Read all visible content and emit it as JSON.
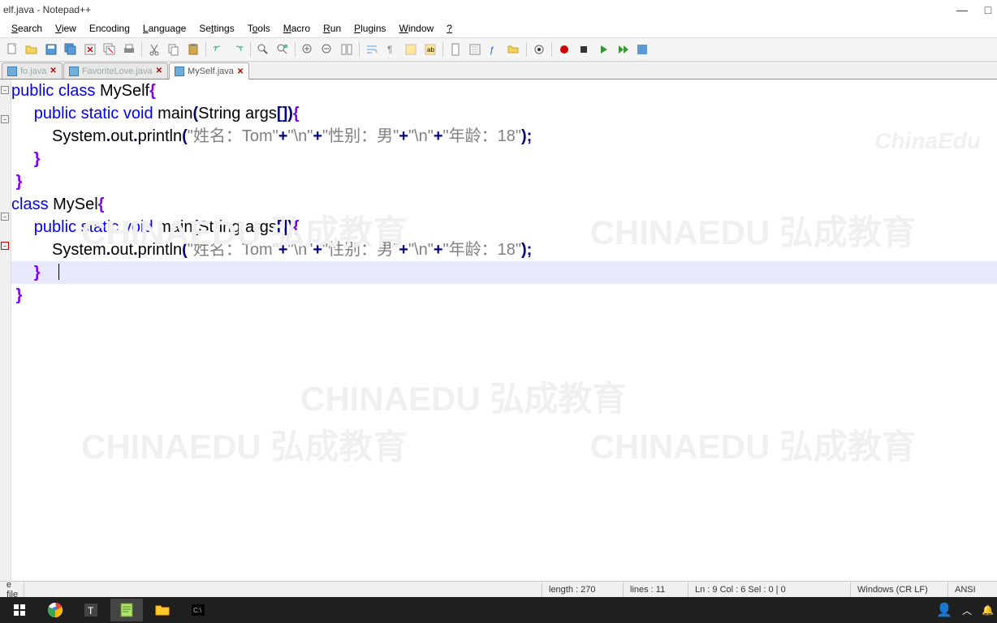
{
  "title": "elf.java - Notepad++",
  "menu": [
    "Search",
    "View",
    "Encoding",
    "Language",
    "Settings",
    "Tools",
    "Macro",
    "Run",
    "Plugins",
    "Window",
    "?"
  ],
  "tabs": [
    {
      "name": "fo.java",
      "active": false
    },
    {
      "name": "FavoriteLove.java",
      "active": false
    },
    {
      "name": "MySelf.java",
      "active": true
    }
  ],
  "code": {
    "line1_kw1": "public",
    "line1_kw2": "class",
    "line1_cls": "MySelf",
    "line2_kw1": "public",
    "line2_kw2": "static",
    "line2_kw3": "void",
    "line2_fn": "main",
    "line2_param": "String args",
    "line3_obj": "System",
    "line3_m1": "out",
    "line3_m2": "println",
    "line3_s1": "\"姓名：Tom\"",
    "line3_s2": "\"\\n\"",
    "line3_s3": "\"性别：男\"",
    "line3_s4": "\"\\n\"",
    "line3_s5": "\"年龄：18\"",
    "line4_brace": "}",
    "line5_brace": "}",
    "line6_kw1": "class",
    "line6_cls": "MySel",
    "line7_kw1": "public",
    "line7_kw2": "static",
    "line7_kw3": "void",
    "line7_fn": "main",
    "line7_param": "String args",
    "line8_obj": "System",
    "line8_m1": "out",
    "line8_m2": "println",
    "line8_s1": "\"姓名：Tom\"",
    "line8_s2": "\"\\n\"",
    "line8_s3": "\"性别：男\"",
    "line8_s4": "\"\\n\"",
    "line8_s5": "\"年龄：18\"",
    "line9_brace": "}",
    "line10_brace": "}"
  },
  "status": {
    "file_label": "e file",
    "length": "length : 270",
    "lines": "lines : 11",
    "pos": "Ln : 9    Col : 6    Sel : 0 | 0",
    "eol": "Windows (CR LF)",
    "encoding": "ANSI"
  },
  "watermarks": {
    "logo": "ChinaEdu",
    "text": "CHINAEDU 弘成教育"
  }
}
